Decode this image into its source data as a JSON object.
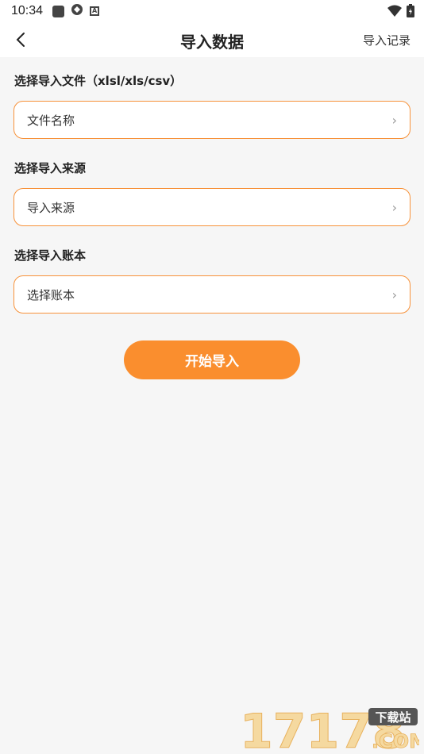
{
  "status_bar": {
    "time": "10:34",
    "icons": [
      "notification-square-icon",
      "sync-icon",
      "a-icon",
      "wifi-icon",
      "battery-icon"
    ]
  },
  "app_bar": {
    "title": "导入数据",
    "right_action": "导入记录",
    "back_icon": "chevron-left-icon"
  },
  "sections": [
    {
      "label": "选择导入文件（xlsl/xls/csv）",
      "placeholder": "文件名称"
    },
    {
      "label": "选择导入来源",
      "placeholder": "导入来源"
    },
    {
      "label": "选择导入账本",
      "placeholder": "选择账本"
    }
  ],
  "actions": {
    "start_label": "开始导入"
  },
  "watermark": {
    "number": "17178",
    "badge": "下载站",
    "suffix": ".COM"
  },
  "colors": {
    "accent": "#fa8e2e",
    "border": "#f7923a",
    "background": "#f6f6f6"
  }
}
